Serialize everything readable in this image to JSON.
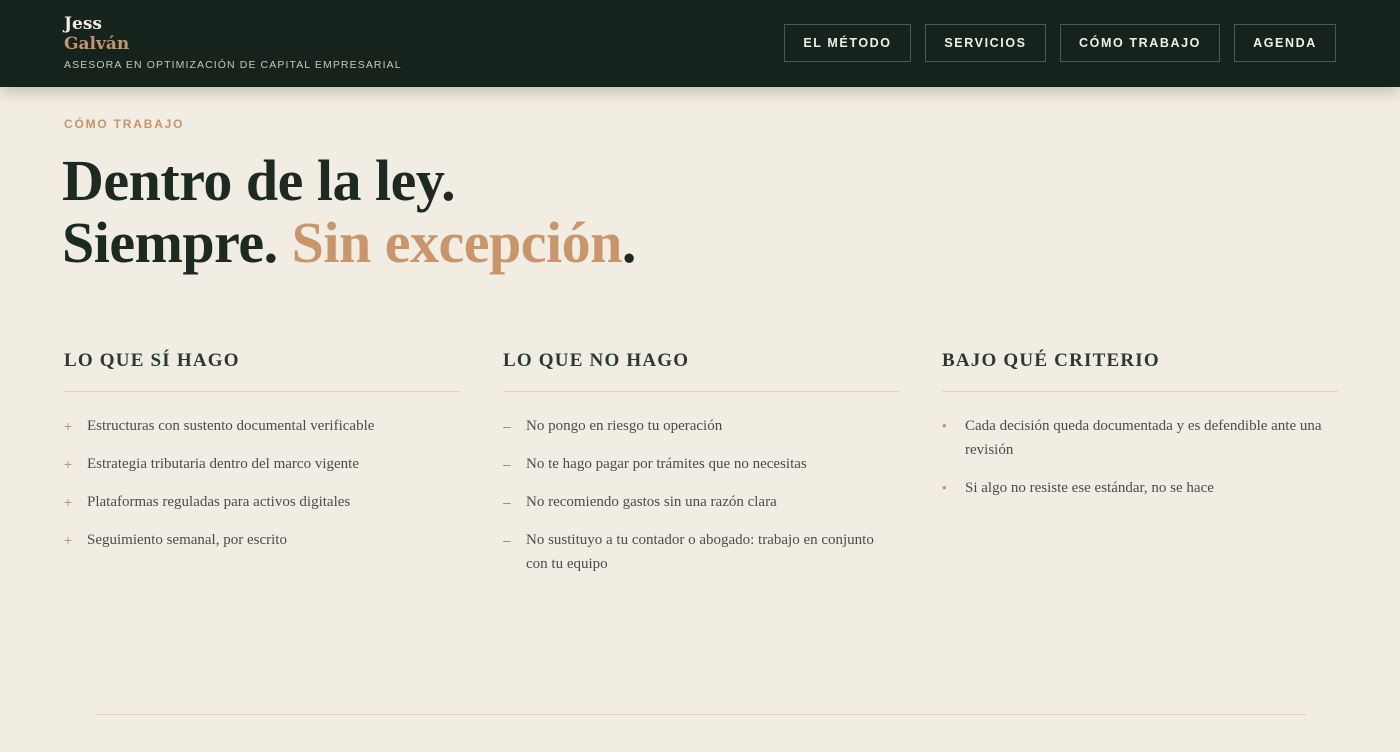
{
  "brand": {
    "first_name": "Jess",
    "last_name": "Galván",
    "tagline": "ASESORA EN OPTIMIZACIÓN DE CAPITAL EMPRESARIAL"
  },
  "nav": {
    "items": [
      {
        "label": "EL MÉTODO"
      },
      {
        "label": "SERVICIOS"
      },
      {
        "label": "CÓMO TRABAJO"
      },
      {
        "label": "AGENDA"
      }
    ]
  },
  "hero": {
    "eyebrow": "CÓMO TRABAJO",
    "line1": "Dentro de la ley.",
    "line2_start": "Siempre. ",
    "line2_accent": "Sin excepción",
    "line2_end": "."
  },
  "columns": [
    {
      "title": "LO QUE SÍ HAGO",
      "marker": "+",
      "items": [
        "Estructuras con sustento documental verificable",
        "Estrategia tributaria dentro del marco vigente",
        "Plataformas reguladas para activos digitales",
        "Seguimiento semanal, por escrito"
      ]
    },
    {
      "title": "LO QUE NO HAGO",
      "marker": "–",
      "items": [
        "No pongo en riesgo tu operación",
        "No te hago pagar por trámites que no necesitas",
        "No recomiendo gastos sin una razón clara",
        "No sustituyo a tu contador o abogado: trabajo en conjunto con tu equipo"
      ]
    },
    {
      "title": "BAJO QUÉ CRITERIO",
      "marker": "•",
      "items": [
        "Cada decisión queda documentada y es defendible ante una revisión",
        "Si algo no resiste ese estándar, no se hace"
      ]
    }
  ],
  "colors": {
    "header_bg": "#15231c",
    "page_bg": "#f2ede3",
    "accent": "#c5946a",
    "text_dark": "#1c2a22"
  }
}
